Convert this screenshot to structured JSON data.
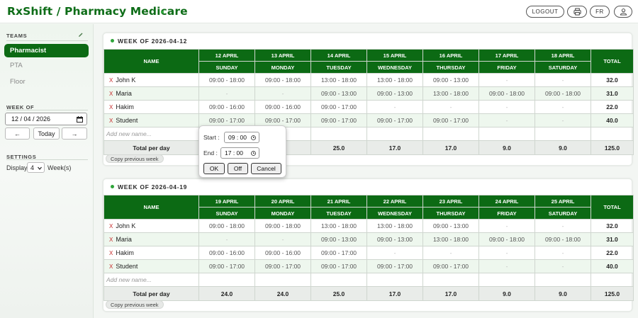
{
  "header": {
    "title": "RxShift / Pharmacy Medicare",
    "logout_label": "LOGOUT",
    "lang_label": "FR",
    "icons": [
      "printer-icon",
      "user-icon"
    ]
  },
  "sidebar": {
    "teams_title": "TEAMS",
    "teams": [
      {
        "label": "Pharmacist",
        "active": true
      },
      {
        "label": "PTA",
        "active": false
      },
      {
        "label": "Floor",
        "active": false
      }
    ],
    "week_of_title": "WEEK OF",
    "week_of_value": "12 / 04 / 2026",
    "prev_label": "←",
    "today_label": "Today",
    "next_label": "→",
    "settings_title": "SETTINGS",
    "display_label": "Display",
    "display_value": "4",
    "weeks_label": "Week(s)"
  },
  "weeks": [
    {
      "title": "WEEK OF 2026-04-12",
      "name_header": "NAME",
      "total_header": "TOTAL",
      "days": [
        {
          "date": "12 APRIL",
          "day": "SUNDAY"
        },
        {
          "date": "13 APRIL",
          "day": "MONDAY"
        },
        {
          "date": "14 APRIL",
          "day": "TUESDAY"
        },
        {
          "date": "15 APRIL",
          "day": "WEDNESDAY"
        },
        {
          "date": "16 APRIL",
          "day": "THURSDAY"
        },
        {
          "date": "17 APRIL",
          "day": "FRIDAY"
        },
        {
          "date": "18 APRIL",
          "day": "SATURDAY"
        }
      ],
      "rows": [
        {
          "name": "John K",
          "cells": [
            "09:00 - 18:00",
            "09:00 - 18:00",
            "13:00 - 18:00",
            "13:00 - 18:00",
            "09:00 - 13:00",
            "-",
            "-"
          ],
          "total": "32.0"
        },
        {
          "name": "Maria",
          "cells": [
            "-",
            "-",
            "09:00 - 13:00",
            "09:00 - 13:00",
            "13:00 - 18:00",
            "09:00 - 18:00",
            "09:00 - 18:00"
          ],
          "total": "31.0"
        },
        {
          "name": "Hakim",
          "cells": [
            "09:00 - 16:00",
            "09:00 - 16:00",
            "09:00 - 17:00",
            "-",
            "-",
            "-",
            "-"
          ],
          "total": "22.0"
        },
        {
          "name": "Student",
          "cells": [
            "09:00 - 17:00",
            "09:00 - 17:00",
            "09:00 - 17:00",
            "09:00 - 17:00",
            "09:00 - 17:00",
            "-",
            "-"
          ],
          "total": "40.0"
        }
      ],
      "new_name_placeholder": "Add new name...",
      "totals_label": "Total per day",
      "totals": [
        "",
        "",
        "25.0",
        "17.0",
        "17.0",
        "9.0",
        "9.0"
      ],
      "grand_total": "125.0",
      "copy_label": "Copy previous week"
    },
    {
      "title": "WEEK OF 2026-04-19",
      "name_header": "NAME",
      "total_header": "TOTAL",
      "days": [
        {
          "date": "19 APRIL",
          "day": "SUNDAY"
        },
        {
          "date": "20 APRIL",
          "day": "MONDAY"
        },
        {
          "date": "21 APRIL",
          "day": "TUESDAY"
        },
        {
          "date": "22 APRIL",
          "day": "WEDNESDAY"
        },
        {
          "date": "23 APRIL",
          "day": "THURSDAY"
        },
        {
          "date": "24 APRIL",
          "day": "FRIDAY"
        },
        {
          "date": "25 APRIL",
          "day": "SATURDAY"
        }
      ],
      "rows": [
        {
          "name": "John K",
          "cells": [
            "09:00 - 18:00",
            "09:00 - 18:00",
            "13:00 - 18:00",
            "13:00 - 18:00",
            "09:00 - 13:00",
            "-",
            "-"
          ],
          "total": "32.0"
        },
        {
          "name": "Maria",
          "cells": [
            "-",
            "-",
            "09:00 - 13:00",
            "09:00 - 13:00",
            "13:00 - 18:00",
            "09:00 - 18:00",
            "09:00 - 18:00"
          ],
          "total": "31.0"
        },
        {
          "name": "Hakim",
          "cells": [
            "09:00 - 16:00",
            "09:00 - 16:00",
            "09:00 - 17:00",
            "-",
            "-",
            "-",
            "-"
          ],
          "total": "22.0"
        },
        {
          "name": "Student",
          "cells": [
            "09:00 - 17:00",
            "09:00 - 17:00",
            "09:00 - 17:00",
            "09:00 - 17:00",
            "09:00 - 17:00",
            "-",
            "-"
          ],
          "total": "40.0"
        }
      ],
      "new_name_placeholder": "Add new name...",
      "totals_label": "Total per day",
      "totals": [
        "24.0",
        "24.0",
        "25.0",
        "17.0",
        "17.0",
        "9.0",
        "9.0"
      ],
      "grand_total": "125.0",
      "copy_label": "Copy previous week"
    }
  ],
  "popup": {
    "start_label": "Start :",
    "start_value": "09 : 00",
    "end_label": "End :",
    "end_value": "17 : 00",
    "ok_label": "OK",
    "off_label": "Off",
    "cancel_label": "Cancel"
  },
  "colors": {
    "brand": "#0e6d18",
    "header_bg": "#0c6a14",
    "accent_dot": "#2ea43a",
    "remove_x": "#c62828",
    "alt_row": "#eef7ee"
  }
}
